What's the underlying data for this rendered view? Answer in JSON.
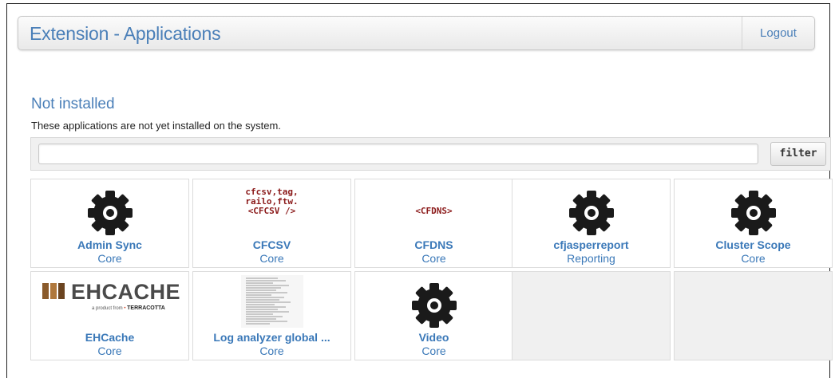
{
  "header": {
    "title": "Extension - Applications",
    "logout_label": "Logout"
  },
  "section": {
    "title": "Not installed",
    "description": "These applications are not yet installed on the system."
  },
  "filter": {
    "input_value": "",
    "button_label": "filter"
  },
  "colors": {
    "link": "#3a78b8",
    "code": "#8b1a1a",
    "gear": "#1a1a1a"
  },
  "apps": [
    {
      "name": "Admin Sync",
      "category": "Core",
      "icon": "gear-icon"
    },
    {
      "name": "CFCSV",
      "category": "Core",
      "icon": "cfcsv-code-icon",
      "code_lines": [
        "cfcsv,tag,",
        "railo,ftw.",
        "<CFCSV />"
      ]
    },
    {
      "name": "CFDNS",
      "category": "Core",
      "icon": "cfdns-code-icon",
      "code_lines": [
        "<CFDNS>"
      ]
    },
    {
      "name": "cfjasperreport",
      "category": "Reporting",
      "icon": "gear-icon"
    },
    {
      "name": "Cluster Scope",
      "category": "Core",
      "icon": "gear-icon"
    },
    {
      "name": "EHCache",
      "category": "Core",
      "icon": "ehcache-logo",
      "logo_text": "EHCACHE",
      "logo_sub": "a product from",
      "logo_brand": "TERRACOTTA"
    },
    {
      "name": "Log analyzer global ...",
      "category": "Core",
      "icon": "log-thumbnail"
    },
    {
      "name": "Video",
      "category": "Core",
      "icon": "gear-icon"
    }
  ]
}
